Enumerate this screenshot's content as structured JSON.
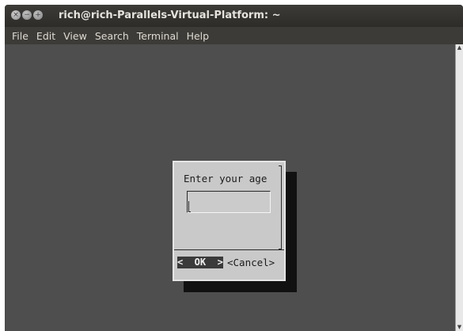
{
  "window": {
    "title": "rich@rich-Parallels-Virtual-Platform: ~",
    "controls": {
      "close": "×",
      "minimize": "−",
      "maximize": "+"
    }
  },
  "menubar": {
    "items": [
      "File",
      "Edit",
      "View",
      "Search",
      "Terminal",
      "Help"
    ]
  },
  "dialog": {
    "prompt": "Enter your age",
    "input_value": "",
    "ok_label": "<  OK  >",
    "cancel_label": "<Cancel>"
  },
  "scrollbar": {
    "up_arrow": "▲",
    "down_arrow": "▼"
  },
  "colors": {
    "titlebar": "#3c3b37",
    "terminal_background": "#4e4e4e",
    "dialog_background": "#c9c9c9",
    "ok_highlight": "#3a3a3a"
  }
}
